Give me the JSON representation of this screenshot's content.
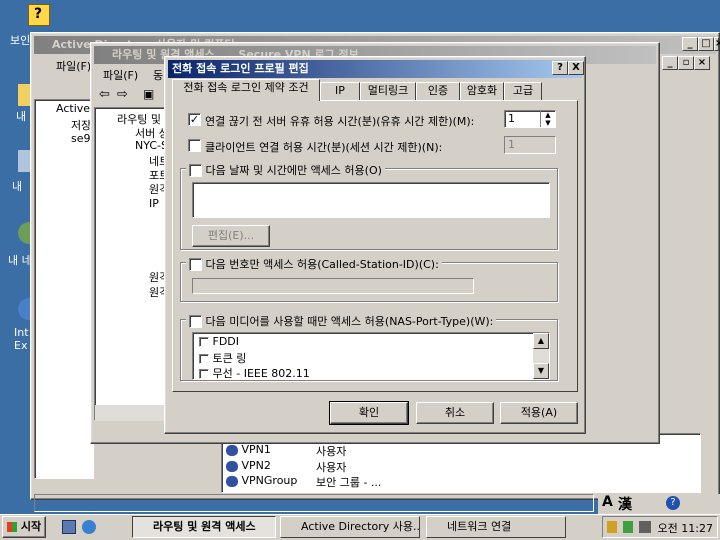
{
  "desktop": {
    "icon_labels": [
      "보인",
      "내",
      "내",
      "내 네",
      "Int Ex"
    ]
  },
  "ad_window": {
    "title": "Active Directory 사용자 및 컴퓨터",
    "menu": [
      "파일(F)"
    ],
    "tree_root": "Active",
    "tree_items": [
      "저장",
      "se9"
    ]
  },
  "rras_window": {
    "title": "라우팅 및 원격 액세스",
    "bg_title": "Secure VPN 로그 정보",
    "menu": [
      "파일(F)",
      "동"
    ],
    "tree": [
      "라우팅 및",
      "서버 상",
      "NYC-S",
      "네트",
      "포트",
      "원격",
      "IP",
      "원격",
      "원격"
    ]
  },
  "list_panel": {
    "rows": [
      {
        "name": "VPN1",
        "type": "사용자"
      },
      {
        "name": "VPN2",
        "type": "사용자"
      },
      {
        "name": "VPNGroup",
        "type": "보안 그룹 - ..."
      }
    ]
  },
  "dialog": {
    "title": "전화 접속 로그인 프로필 편집",
    "help_label": "?",
    "close_label": "X",
    "tabs": [
      "전화 접속 로그인 제약 조건",
      "IP",
      "멀티링크",
      "인증",
      "암호화",
      "고급"
    ],
    "opt_disconnect": {
      "label": "연결 끊기 전 서버 유휴 허용 시간(분)(유휴 시간 제한)(M):",
      "checked": "✓",
      "value": "1"
    },
    "opt_session": {
      "label": "클라이언트 연결 허용 시간(분)(세션 시간 제한)(N):",
      "value": "1"
    },
    "opt_daytime": {
      "label": "다음 날짜 및 시간에만 액세스 허용(O)",
      "edit_button": "편집(E)..."
    },
    "opt_called": {
      "label": "다음 번호만 액세스 허용(Called-Station-ID)(C):"
    },
    "opt_media": {
      "label": "다음 미디어를 사용할 때만 액세스 허용(NAS-Port-Type)(W):",
      "items": [
        "FDDI",
        "토큰 링",
        "무선 - IEEE 802.11"
      ]
    },
    "buttons": {
      "ok": "확인",
      "cancel": "취소",
      "apply": "적용(A)"
    }
  },
  "taskbar": {
    "start": "시작",
    "tasks": [
      "라우팅 및 원격 액세스",
      "Active Directory 사용...",
      "네트워크 연결"
    ],
    "clock": "오전 11:27"
  },
  "langbar": {
    "a": "A",
    "han": "漢"
  },
  "colors": {
    "desktop": "#3a6ea5",
    "titlebar": "#0a246a",
    "face": "#d4d0c8"
  }
}
